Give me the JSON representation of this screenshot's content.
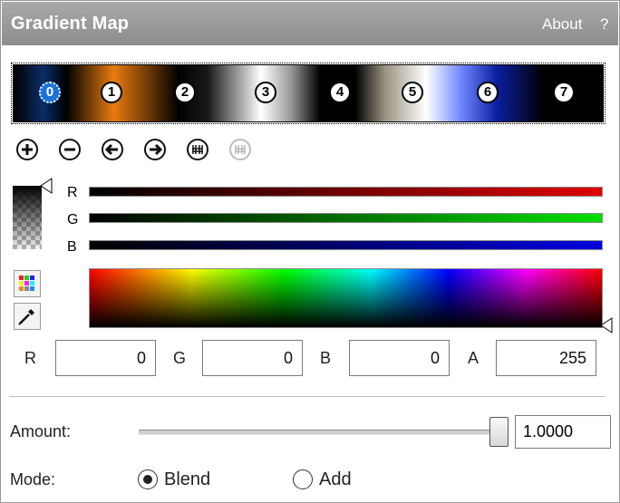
{
  "panel": {
    "title": "Gradient Map",
    "about_label": "About",
    "help_label": "?"
  },
  "gradient": {
    "stops": [
      {
        "label": "0",
        "selected": true
      },
      {
        "label": "1",
        "selected": false
      },
      {
        "label": "2",
        "selected": false
      },
      {
        "label": "3",
        "selected": false
      },
      {
        "label": "4",
        "selected": false
      },
      {
        "label": "5",
        "selected": false
      },
      {
        "label": "6",
        "selected": false
      },
      {
        "label": "7",
        "selected": false
      }
    ]
  },
  "toolbar": {
    "buttons": [
      {
        "icon": "plus-icon",
        "enabled": true
      },
      {
        "icon": "minus-icon",
        "enabled": true
      },
      {
        "icon": "arrow-left-icon",
        "enabled": true
      },
      {
        "icon": "arrow-right-icon",
        "enabled": true
      },
      {
        "icon": "reverse-icon",
        "enabled": true
      },
      {
        "icon": "distribute-icon",
        "enabled": false
      }
    ]
  },
  "channels": {
    "r_label": "R",
    "g_label": "G",
    "b_label": "B",
    "r_level": 0,
    "g_level": 0,
    "b_level": 0
  },
  "fields": {
    "r_label": "R",
    "r_value": "0",
    "g_label": "G",
    "g_value": "0",
    "b_label": "B",
    "b_value": "0",
    "a_label": "A",
    "a_value": "255"
  },
  "amount": {
    "label": "Amount:",
    "value": "1.0000",
    "level": 1.0
  },
  "mode": {
    "label": "Mode:",
    "options": [
      {
        "label": "Blend",
        "checked": true
      },
      {
        "label": "Add",
        "checked": false
      }
    ]
  },
  "colors": {
    "accent": "#1d72d6",
    "title_bar": "#9b9b9b",
    "red": "#e00000",
    "green": "#00e000",
    "blue": "#0000e0"
  }
}
